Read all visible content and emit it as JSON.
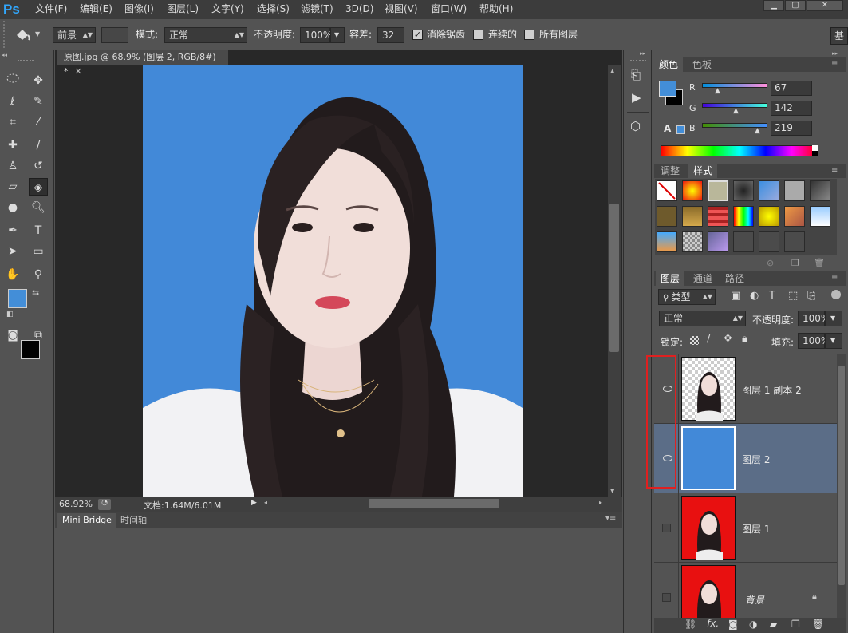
{
  "app": {
    "logo": "Ps"
  },
  "menu": [
    "文件(F)",
    "编辑(E)",
    "图像(I)",
    "图层(L)",
    "文字(Y)",
    "选择(S)",
    "滤镜(T)",
    "3D(D)",
    "视图(V)",
    "窗口(W)",
    "帮助(H)"
  ],
  "window_controls": {
    "minimize": "▁",
    "maximize": "▢",
    "close": "✕"
  },
  "options": {
    "fill_source": "前景",
    "mode_label": "模式:",
    "mode_value": "正常",
    "opacity_label": "不透明度:",
    "opacity_value": "100%",
    "tolerance_label": "容差:",
    "tolerance_value": "32",
    "antialias_label": "消除锯齿",
    "antialias_checked": true,
    "contiguous_label": "连续的",
    "contiguous_checked": false,
    "all_layers_label": "所有图层",
    "all_layers_checked": false,
    "workspace_btn": "基"
  },
  "document": {
    "tab_title": "原图.jpg @ 68.9% (图层 2, RGB/8#) *",
    "zoom": "68.92%",
    "doc_size": "文档:1.64M/6.01M",
    "canvas_bg": "#4289d8"
  },
  "bottom_panel": {
    "tabs": [
      "Mini Bridge",
      "时间轴"
    ]
  },
  "color_panel": {
    "tabs": [
      "颜色",
      "色板"
    ],
    "foreground": "#438ed8",
    "background": "#000000",
    "channels": [
      {
        "name": "R",
        "value": "67"
      },
      {
        "name": "G",
        "value": "142"
      },
      {
        "name": "B",
        "value": "219"
      }
    ]
  },
  "styles_panel": {
    "tabs": [
      "调整",
      "样式"
    ]
  },
  "layers_panel": {
    "tabs": [
      "图层",
      "通道",
      "路径"
    ],
    "filter_label": "类型",
    "blend_mode": "正常",
    "opacity_label": "不透明度:",
    "opacity_value": "100%",
    "lock_label": "锁定:",
    "fill_label": "填充:",
    "fill_value": "100%",
    "layers": [
      {
        "name": "图层 1 副本 2",
        "visible": true,
        "selected": false,
        "thumb": "transparent-portrait"
      },
      {
        "name": "图层 2",
        "visible": true,
        "selected": true,
        "thumb": "blue-fill"
      },
      {
        "name": "图层 1",
        "visible": false,
        "selected": false,
        "thumb": "red-portrait"
      },
      {
        "name": "背景",
        "visible": false,
        "selected": false,
        "thumb": "red-portrait",
        "locked": true
      }
    ]
  },
  "colors": {
    "highlight_box": "#e02020",
    "selected_layer": "#5b6d87"
  }
}
